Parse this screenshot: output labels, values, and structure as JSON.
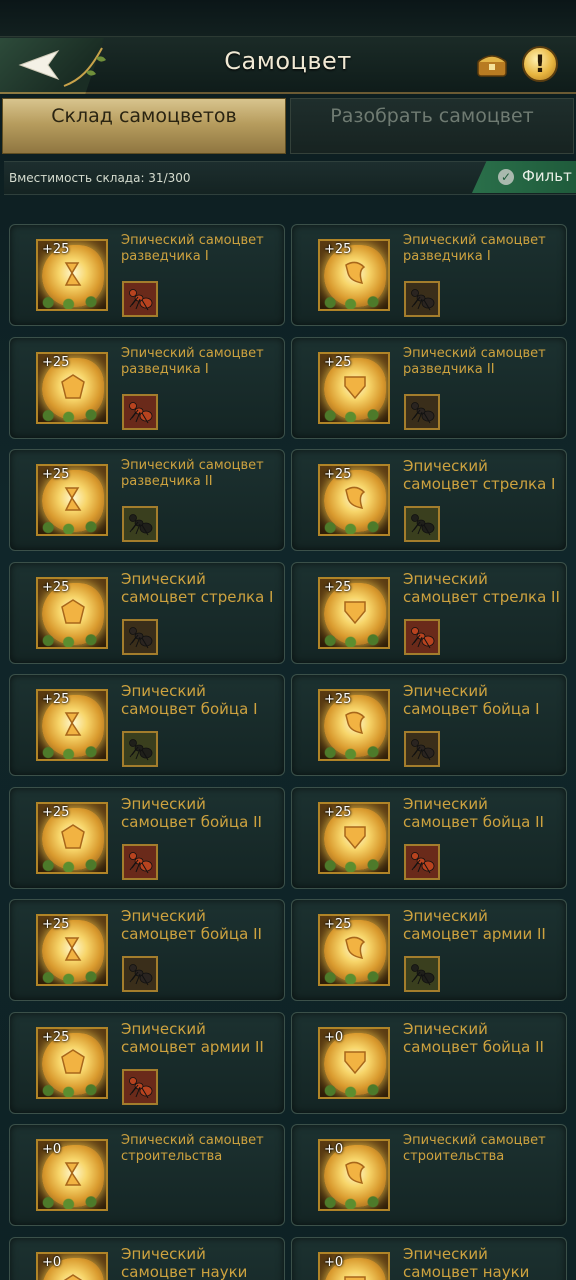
{
  "header": {
    "title": "Самоцвет",
    "back_icon": "back-arrow-icon",
    "chest_icon": "treasure-chest-icon",
    "info_icon": "exclamation-icon",
    "info_label": "!"
  },
  "tabs": [
    {
      "label": "Склад самоцветов",
      "active": true
    },
    {
      "label": "Разобрать самоцвет",
      "active": false
    }
  ],
  "capacity": {
    "text": "Вместимость склада: 31/300",
    "filter_label": "Фильт",
    "filter_icon": "check-circle-icon"
  },
  "colors": {
    "accent_gold": "#cda23f",
    "active_tab": "#c9b47c",
    "filter_green": "#2a6f4a"
  },
  "items": [
    {
      "level": "+25",
      "name": "Эпический самоцвет разведчика I",
      "ant": "red"
    },
    {
      "level": "+25",
      "name": "Эпический самоцвет разведчика I",
      "ant": "dark"
    },
    {
      "level": "+25",
      "name": "Эпический самоцвет разведчика I",
      "ant": "red"
    },
    {
      "level": "+25",
      "name": "Эпический самоцвет разведчика II",
      "ant": "dark"
    },
    {
      "level": "+25",
      "name": "Эпический самоцвет разведчика II",
      "ant": "green"
    },
    {
      "level": "+25",
      "name": "Эпический самоцвет стрелка I",
      "ant": "green"
    },
    {
      "level": "+25",
      "name": "Эпический самоцвет стрелка I",
      "ant": "dark"
    },
    {
      "level": "+25",
      "name": "Эпический самоцвет стрелка II",
      "ant": "red"
    },
    {
      "level": "+25",
      "name": "Эпический самоцвет бойца I",
      "ant": "green"
    },
    {
      "level": "+25",
      "name": "Эпический самоцвет бойца I",
      "ant": "dark"
    },
    {
      "level": "+25",
      "name": "Эпический самоцвет бойца II",
      "ant": "red"
    },
    {
      "level": "+25",
      "name": "Эпический самоцвет бойца II",
      "ant": "red"
    },
    {
      "level": "+25",
      "name": "Эпический самоцвет бойца II",
      "ant": "dark"
    },
    {
      "level": "+25",
      "name": "Эпический самоцвет армии II",
      "ant": "green"
    },
    {
      "level": "+25",
      "name": "Эпический самоцвет армии II",
      "ant": "red"
    },
    {
      "level": "+0",
      "name": "Эпический самоцвет бойца II",
      "ant": "none"
    },
    {
      "level": "+0",
      "name": "Эпический самоцвет строительства",
      "ant": "none"
    },
    {
      "level": "+0",
      "name": "Эпический самоцвет строительства",
      "ant": "none"
    },
    {
      "level": "+0",
      "name": "Эпический самоцвет науки",
      "ant": "none"
    },
    {
      "level": "+0",
      "name": "Эпический самоцвет науки",
      "ant": "none"
    }
  ]
}
